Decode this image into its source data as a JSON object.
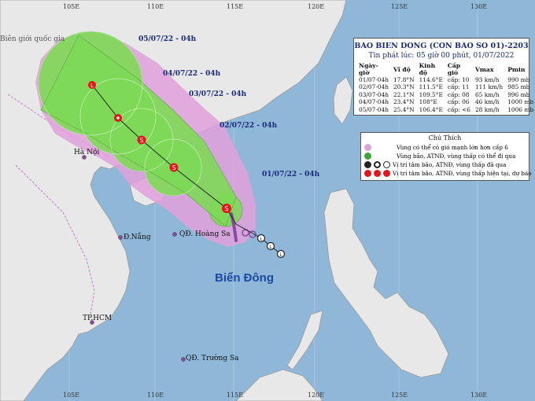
{
  "info": {
    "title": "BAO BIEN DONG (CON BAO SO 01)-2203",
    "issued": "Tin phát lúc: 05 giờ 00 phút, 01/07/2022",
    "headers": [
      "Ngày-giờ",
      "Vĩ độ",
      "Kinh độ",
      "Cấp gió",
      "Vmax",
      "Pmin"
    ],
    "rows": [
      [
        "01/07-04h",
        "17.8°N",
        "114.6°E",
        "cấp: 10",
        "93 km/h",
        "990 mb"
      ],
      [
        "02/07-04h",
        "20.3°N",
        "111.5°E",
        "cấp: 11",
        "111 km/h",
        "985 mb"
      ],
      [
        "03/07-04h",
        "22.1°N",
        "109.5°E",
        "cấp: 08",
        "65 km/h",
        "996 mb"
      ],
      [
        "04/07-04h",
        "23.4°N",
        "108°E",
        "cấp: 06",
        "46 km/h",
        "1000 mb"
      ],
      [
        "05/07-04h",
        "25.4°N",
        "106.4°E",
        "cấp: <6",
        "28 km/h",
        "1006 mb"
      ]
    ]
  },
  "legend": {
    "title": "Chú Thích",
    "items": [
      "Vùng có thể có gió mạnh lớn hơn cấp 6",
      "Vùng bão, ATNĐ, vùng thấp có thể đi qua",
      "Vị trí tâm bão, ATNĐ, vùng thấp đã qua",
      "Vị trí tâm bão, ATNĐ, vùng thấp hiện tại, dự báo"
    ]
  },
  "date_labels": [
    "05/07/22 - 04h",
    "04/07/22 - 04h",
    "03/07/22 - 04h",
    "02/07/22 - 04h",
    "01/07/22 - 04h"
  ],
  "places": {
    "border": "Biên giới quốc gia",
    "hanoi": "Hà Nội",
    "danang": "Đ.Nẵng",
    "hoangsa": "QĐ. Hoàng Sa",
    "hcm": "TP.HCM",
    "truongsa": "QĐ. Trường Sa",
    "sea": "Biển Đông"
  },
  "ticks": {
    "top": [
      "105E",
      "110E",
      "115E",
      "120E",
      "125E",
      "130E"
    ],
    "bottom": [
      "105E",
      "110E",
      "115E",
      "120E",
      "125E",
      "130E"
    ]
  },
  "colors": {
    "sea": "#8fb8d8",
    "land": "#e8e8e8",
    "strong_wind_zone": "#e0a0dc",
    "storm_zone": "#7ed957",
    "track": "#222222",
    "forecast_marker": "#e8131b",
    "past_marker": "#8a4aa0",
    "info_title": "#1a2a7a"
  }
}
